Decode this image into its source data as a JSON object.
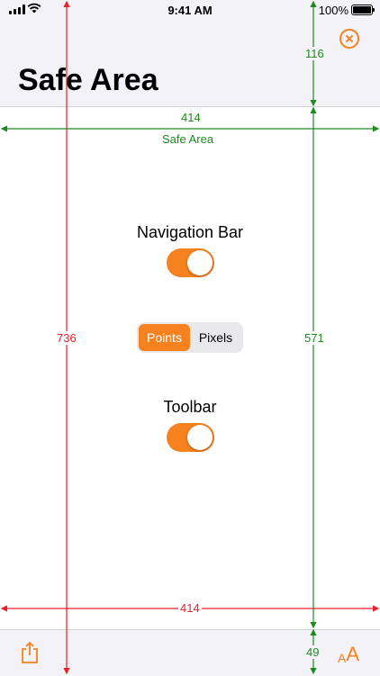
{
  "status_bar": {
    "time": "9:41 AM",
    "battery": "100%"
  },
  "header": {
    "title": "Safe Area"
  },
  "controls": {
    "navigation_bar_label": "Navigation Bar",
    "toolbar_label": "Toolbar",
    "units": {
      "options": [
        "Points",
        "Pixels"
      ],
      "selected": "Points"
    }
  },
  "measurements": {
    "top_inset": "116",
    "safe_area_width": "414",
    "safe_area_label": "Safe Area",
    "screen_height": "736",
    "safe_area_height": "571",
    "screen_width": "414",
    "bottom_inset": "49"
  },
  "toolbar": {
    "text_size_small": "A",
    "text_size_large": "A"
  },
  "colors": {
    "accent": "#f5821f",
    "screen_guides": "#e8202a",
    "safe_area_guides": "#1f8a1f"
  }
}
